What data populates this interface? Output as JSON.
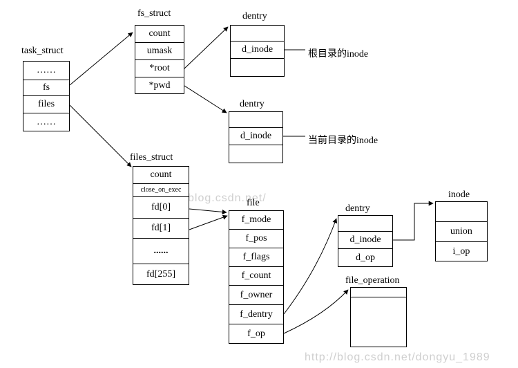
{
  "titles": {
    "task_struct": "task_struct",
    "fs_struct": "fs_struct",
    "files_struct": "files_struct",
    "dentry1": "dentry",
    "dentry2": "dentry",
    "dentry3": "dentry",
    "file": "file",
    "file_operation": "file_operation",
    "inode": "inode"
  },
  "task_struct": {
    "cells": [
      "……",
      "fs",
      "files",
      "……"
    ]
  },
  "fs_struct": {
    "cells": [
      "count",
      "umask",
      "*root",
      "*pwd"
    ]
  },
  "files_struct": {
    "cells": [
      "count",
      "close_on_exec",
      "fd[0]",
      "fd[1]",
      "......",
      "fd[255]"
    ]
  },
  "dentry_root": {
    "cells": [
      "",
      "d_inode",
      ""
    ]
  },
  "dentry_pwd": {
    "cells": [
      "",
      "d_inode",
      ""
    ]
  },
  "file_box": {
    "cells": [
      "f_mode",
      "f_pos",
      "f_flags",
      "f_count",
      "f_owner",
      "f_dentry",
      "f_op"
    ]
  },
  "dentry_file": {
    "cells": [
      "",
      "d_inode",
      "d_op"
    ]
  },
  "inode_box": {
    "cells": [
      "",
      "union",
      "i_op"
    ]
  },
  "annotations": {
    "root_inode": "根目录的inode",
    "pwd_inode": "当前目录的inode"
  },
  "watermark": {
    "line1": "http://blog.csdn.net/",
    "line2": "http://blog.csdn.net/dongyu_1989"
  }
}
